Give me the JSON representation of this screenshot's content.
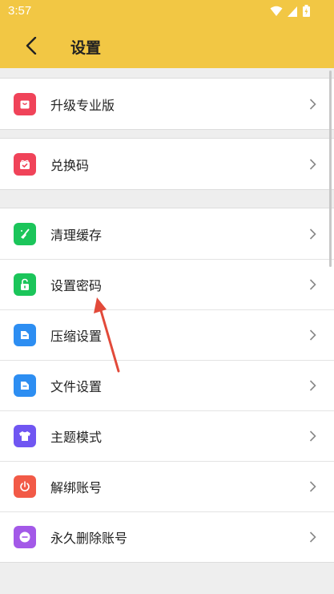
{
  "status_bar": {
    "time": "3:57"
  },
  "header": {
    "title": "设置"
  },
  "groups": [
    {
      "items": [
        {
          "label": "升级专业版"
        }
      ]
    },
    {
      "items": [
        {
          "label": "兑换码"
        }
      ]
    },
    {
      "items": [
        {
          "label": "清理缓存"
        },
        {
          "label": "设置密码"
        },
        {
          "label": "压缩设置"
        },
        {
          "label": "文件设置"
        },
        {
          "label": "主题模式"
        },
        {
          "label": "解绑账号"
        },
        {
          "label": "永久删除账号"
        }
      ]
    }
  ],
  "icons": {
    "upgrade": "shopping-bag-icon",
    "redeem": "gift-icon",
    "clear": "broom-icon",
    "password": "lock-icon",
    "compress": "folder-icon",
    "file": "folder-icon",
    "theme": "shirt-icon",
    "unbind": "power-icon",
    "delete": "minus-circle-icon"
  },
  "colors": {
    "appbar": "#f2c744",
    "upgrade": "#f04359",
    "redeem": "#f04359",
    "clear": "#1bc55a",
    "password": "#1bc55a",
    "compress": "#2d8ef2",
    "file": "#2d8ef2",
    "theme": "#7056f2",
    "unbind": "#f25a47",
    "delete": "#a359e8",
    "annotation_arrow": "#e24a3a"
  }
}
